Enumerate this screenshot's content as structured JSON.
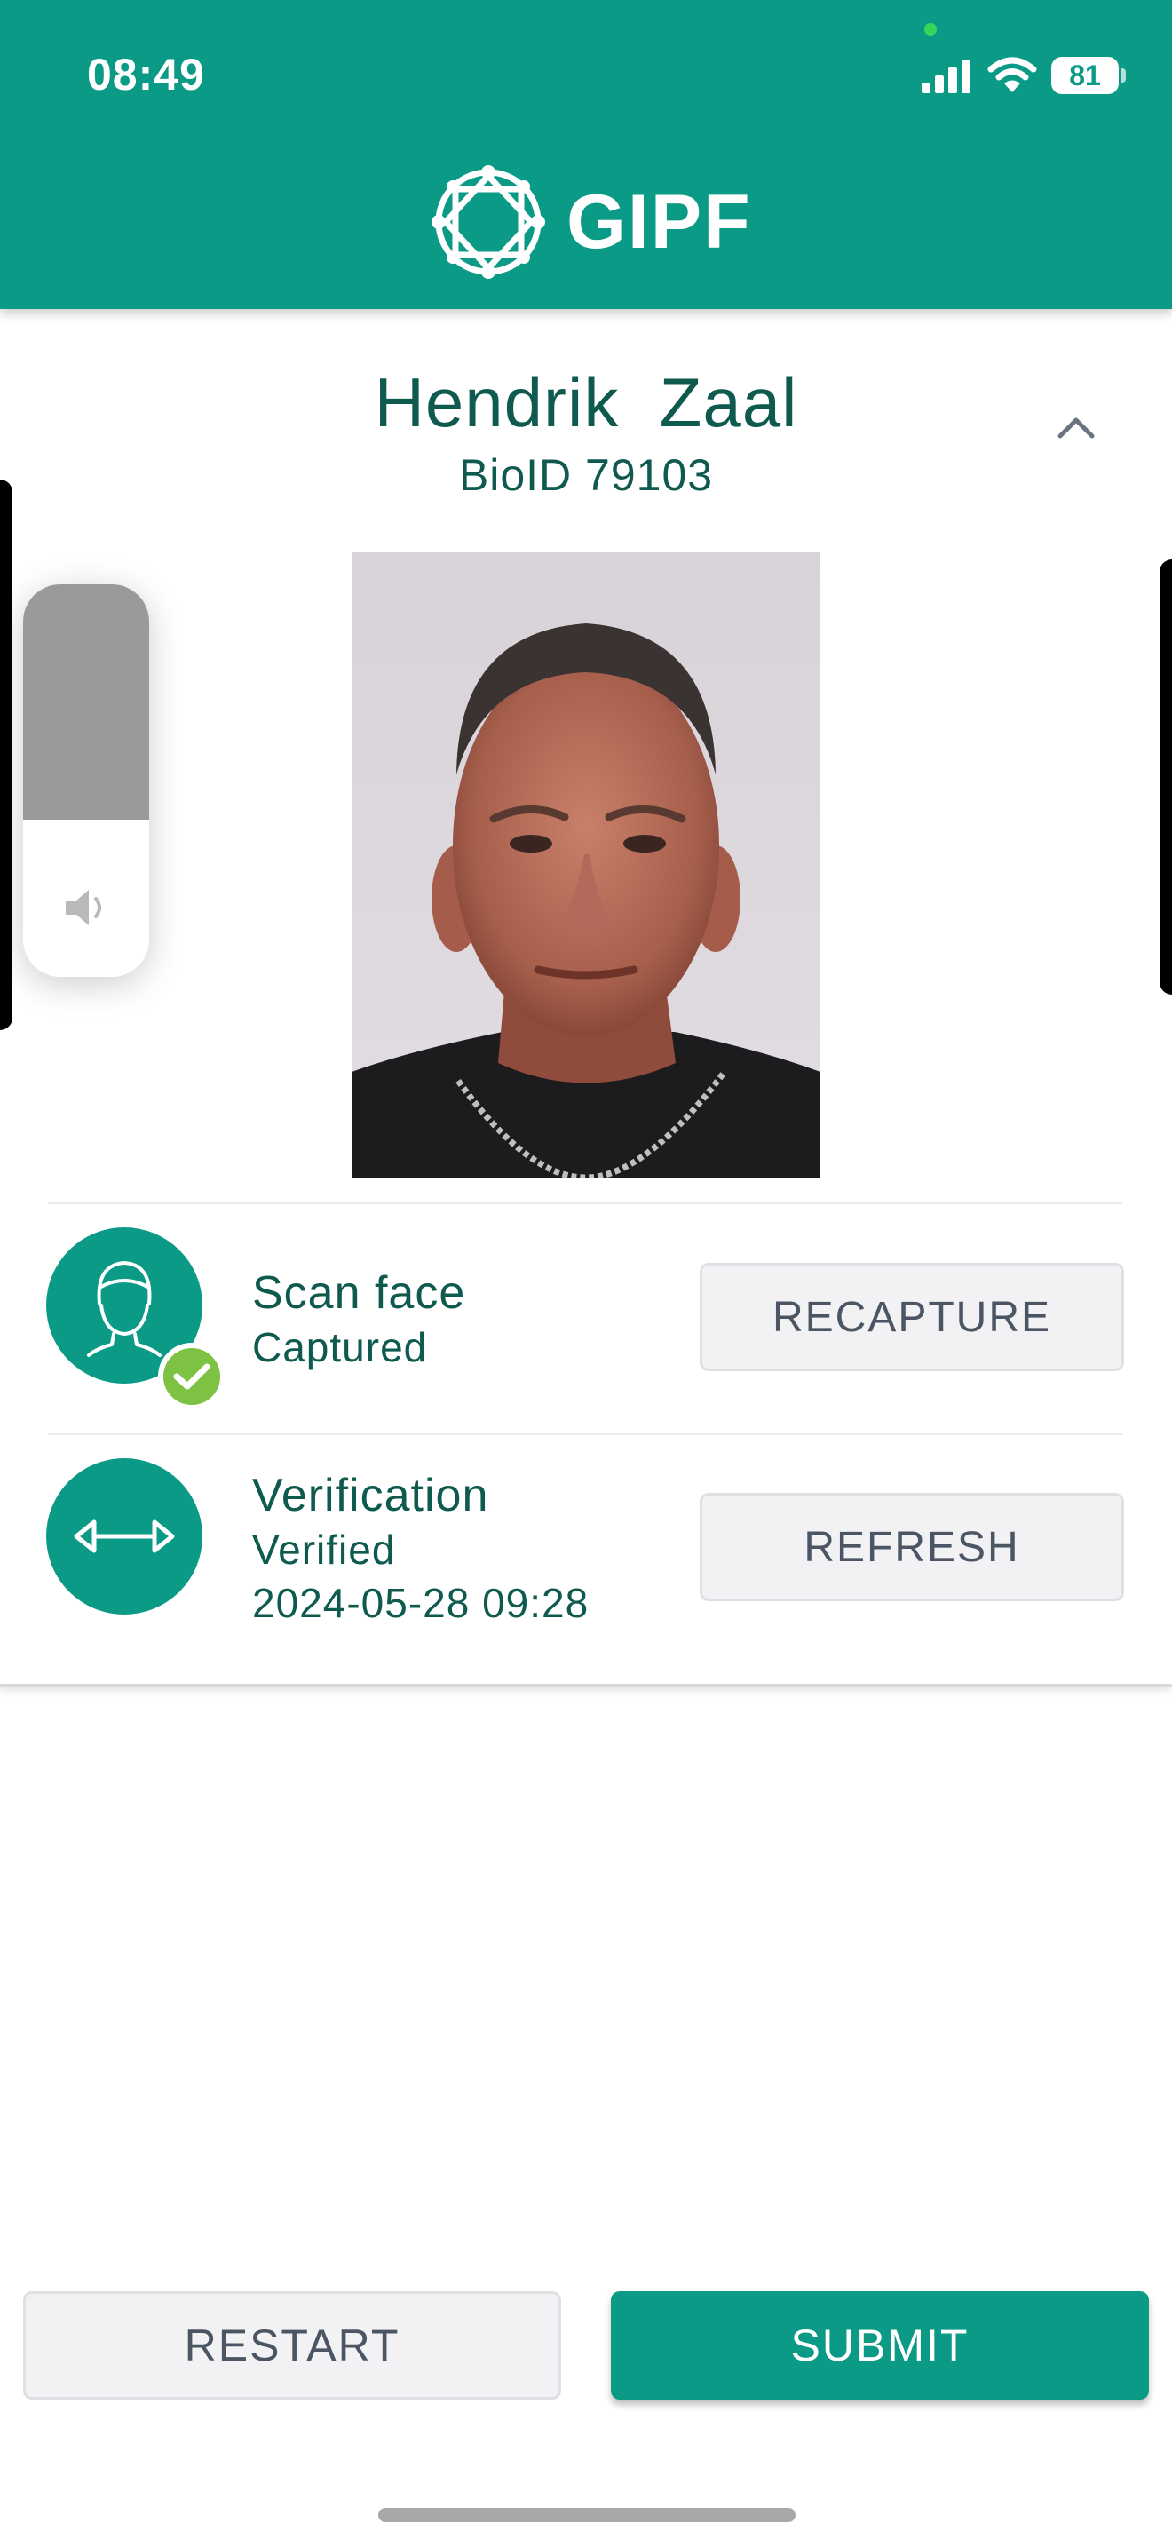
{
  "status_bar": {
    "time": "08:49",
    "battery": "81",
    "icons": [
      "cellular-signal-icon",
      "wifi-icon",
      "battery-icon"
    ]
  },
  "header": {
    "brand": "GIPF",
    "logo_icon": "diamond-ring-logo-icon",
    "color": "#0b9a86"
  },
  "person": {
    "name": "Hendrik  Zaal",
    "bio_id": "BioID 79103",
    "photo_icon": "portrait-photo"
  },
  "steps": [
    {
      "title": "Scan face",
      "status": "Captured",
      "icon": "face-outline-icon",
      "badge_icon": "check-icon",
      "badge_color": "#7dc242",
      "action": "RECAPTURE"
    },
    {
      "title": "Verification",
      "status": "Verified",
      "timestamp": "2024-05-28 09:28",
      "icon": "double-arrow-icon",
      "action": "REFRESH"
    }
  ],
  "volume": {
    "level": 0.4,
    "icon": "speaker-icon"
  },
  "footer": {
    "restart": "RESTART",
    "submit": "SUBMIT"
  }
}
